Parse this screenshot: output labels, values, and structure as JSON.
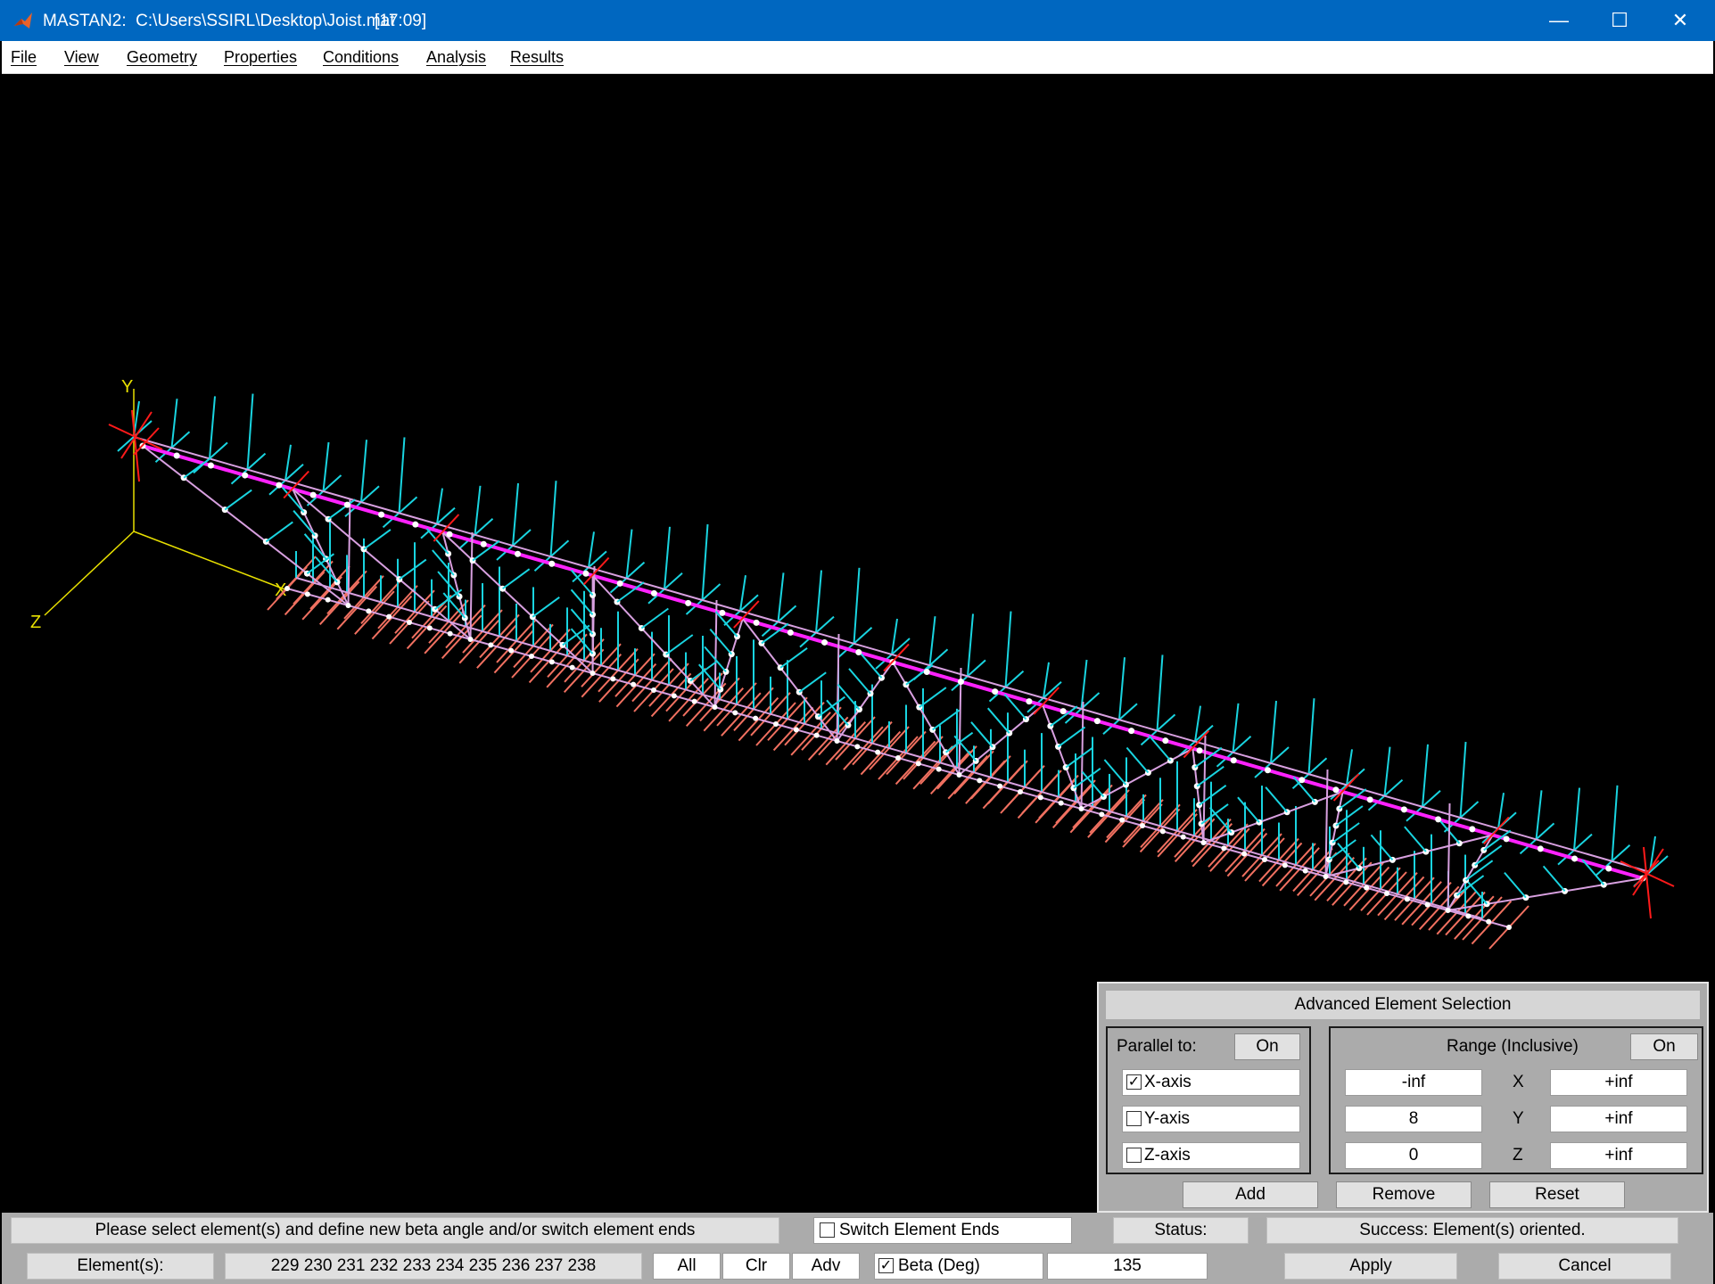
{
  "window": {
    "title": "MASTAN2:  C:\\Users\\SSIRL\\Desktop\\Joist.mat",
    "time": "[17:09]",
    "minimize_glyph": "—",
    "maximize_glyph": "☐",
    "close_glyph": "✕"
  },
  "menu": [
    "File",
    "View",
    "Geometry",
    "Properties",
    "Conditions",
    "Analysis",
    "Results"
  ],
  "canvas": {
    "axis_labels": {
      "x": "X",
      "y": "Y",
      "z": "Z"
    },
    "colors": {
      "background": "#000000",
      "axes": "#e8e000",
      "members": "#d8a0e0",
      "highlight": "#ff22ff",
      "nodes": "#ffffff",
      "local_y_axes": "#19d4e0",
      "local_z_axes": "#f07060",
      "supports": "#ff1a1a"
    }
  },
  "advanced_selection": {
    "title": "Advanced Element Selection",
    "parallel_label": "Parallel to:",
    "parallel_toggle": "On",
    "axes": [
      {
        "label": "X-axis",
        "checked": true
      },
      {
        "label": "Y-axis",
        "checked": false
      },
      {
        "label": "Z-axis",
        "checked": false
      }
    ],
    "range_label": "Range (Inclusive)",
    "range_toggle": "On",
    "ranges": [
      {
        "axis": "X",
        "min": "-inf",
        "max": "+inf"
      },
      {
        "axis": "Y",
        "min": "8",
        "max": "+inf"
      },
      {
        "axis": "Z",
        "min": "0",
        "max": "+inf"
      }
    ],
    "buttons": {
      "add": "Add",
      "remove": "Remove",
      "reset": "Reset"
    }
  },
  "status_bar": {
    "instruction": "Please select element(s) and define new beta angle and/or switch element ends",
    "switch_ends_label": "Switch Element Ends",
    "switch_ends_checked": false,
    "status_label": "Status:",
    "status_value": "Success: Element(s) oriented."
  },
  "element_bar": {
    "elements_label": "Element(s):",
    "elements_value": "229  230  231  232  233  234  235  236  237  238",
    "all_button": "All",
    "clr_button": "Clr",
    "adv_button": "Adv",
    "beta_label": "Beta (Deg)",
    "beta_checked": true,
    "beta_value": "135",
    "apply_button": "Apply",
    "cancel_button": "Cancel"
  }
}
